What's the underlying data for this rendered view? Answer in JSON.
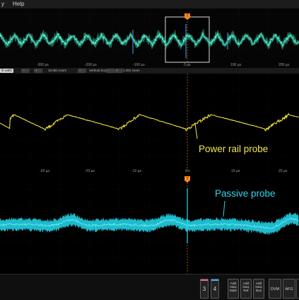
{
  "menu": {
    "items": [
      "y",
      "Help"
    ]
  },
  "overview": {
    "ticks": [
      "-300 µs",
      "-200 µs",
      "-100 µs",
      "0 µs",
      "100 µs",
      "200 µs"
    ],
    "trigger_marker": "T",
    "colors": {
      "trace": "#39d6b0",
      "background": "#050505",
      "zoom_box": "#dcdcdc",
      "trigger": "#ff8c1a"
    }
  },
  "zoombar": {
    "items": [
      "ill width",
      "10.0ks zoom",
      "Vertical Zoom",
      "1.00x zoom"
    ]
  },
  "panes": {
    "power": {
      "ticks": [
        "-30 µs",
        "-20 µs",
        "-10 µs",
        "0 s",
        "10 µs",
        "20 µs"
      ],
      "label": "Power rail probe",
      "color": "#f2e84a"
    },
    "passive": {
      "label": "Passive probe",
      "trigger_marker": "T",
      "color": "#2fd6e8"
    }
  },
  "bottombar": {
    "channels": [
      {
        "label": "3",
        "color": "#f05a9a"
      },
      {
        "label": "4",
        "color": "#4aa0ff"
      }
    ],
    "add_buttons": [
      [
        "Add",
        "New",
        "Math"
      ],
      [
        "Add",
        "New",
        "Ref"
      ],
      [
        "Add",
        "New",
        "Bus"
      ]
    ],
    "dvm_label": "DVM",
    "afg_label": "AFG"
  }
}
